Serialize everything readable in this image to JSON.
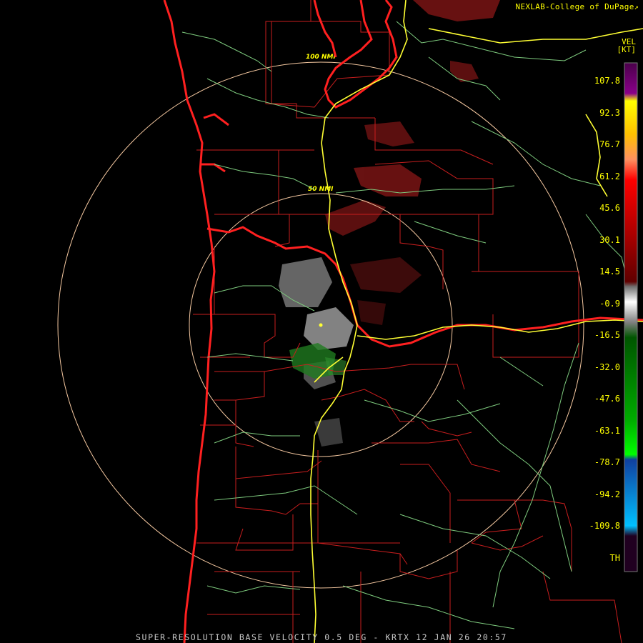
{
  "credit": "NEXLAB-College of DuPage",
  "credit_icon": "external-link-icon",
  "legend": {
    "product": "VEL",
    "unit": "[KT]",
    "ticks": [
      "107.8",
      "92.3",
      "76.7",
      "61.2",
      "45.6",
      "30.1",
      "14.5",
      "-0.9",
      "-16.5",
      "-32.0",
      "-47.6",
      "-63.1",
      "-78.7",
      "-94.2",
      "-109.8",
      "TH"
    ]
  },
  "range_rings": [
    "100 NMI",
    "50 NMI"
  ],
  "footer": "SUPER-RESOLUTION BASE VELOCITY 0.5 DEG - KRTX 12 JAN 26 20:57",
  "colors": {
    "background": "#000000",
    "text": "#ffff00",
    "footer_text": "#c8c8c8",
    "ring": "#f5c8a0",
    "county_border": "#c81e1e",
    "state_border": "#ff2020",
    "highway": "#ffff33",
    "road": "#7ecb7e",
    "inbound_green": "#1f7a1f",
    "outbound_red": "#8b1a1a"
  }
}
